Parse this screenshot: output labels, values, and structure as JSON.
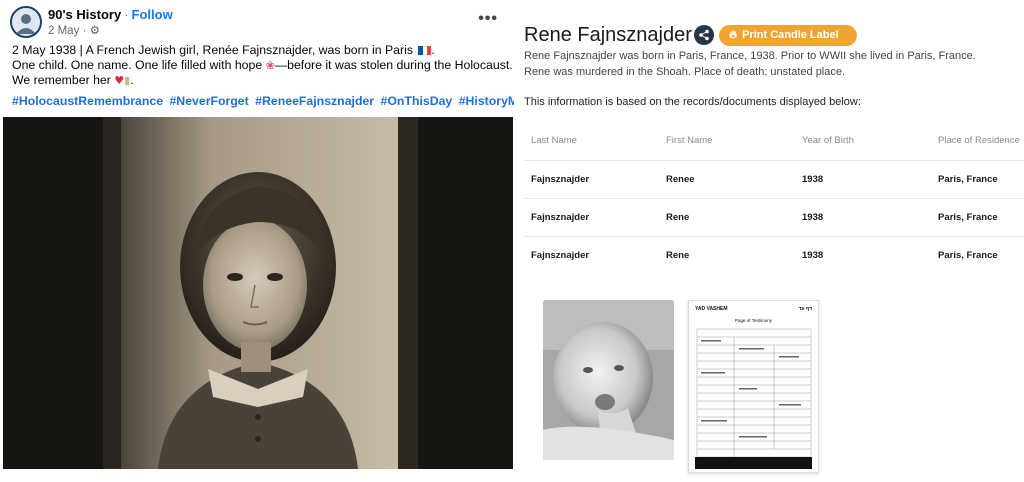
{
  "post": {
    "author": "90's History",
    "separator": "·",
    "follow_label": "Follow",
    "date": "2 May",
    "date_separator": "·",
    "more_label": "•••",
    "lines": [
      "2 May 1938 | A French Jewish girl, Renée Fajnsznajder, was born in Paris",
      "One child. One name. One life filled with hope",
      "—before it was stolen during the Holocaust.",
      "We remember her"
    ],
    "period": ".",
    "hashtags": [
      "#HolocaustRemembrance",
      "#NeverForget",
      "#ReneeFajnsznajder",
      "#OnThisDay",
      "#HistoryMatters"
    ],
    "emoji_flower": "❀",
    "emoji_heart": "♥",
    "icons": {
      "avatar": "avatar-icon",
      "globe": "gear-icon",
      "flag": "france-flag-icon",
      "more": "more-icon"
    },
    "flag_colors": [
      "#0055a4",
      "#ffffff",
      "#ef4135"
    ]
  },
  "record": {
    "title": "Rene Fajnsznajder",
    "share_icon": "share-icon",
    "candle_icon": "flame-icon",
    "candle_label": "Print Candle Label",
    "description": [
      "Rene Fajnsznajder was born in Paris, France, 1938. Prior to WWII she lived in Paris, France.",
      "Rene was murdered in the Shoah. Place of death: unstated place."
    ],
    "info": "This information is based on the records/documents displayed below:",
    "table": {
      "headers": [
        "Last Name",
        "First Name",
        "Year of Birth",
        "Place of Residence"
      ],
      "rows": [
        [
          "Fajnsznajder",
          "Renee",
          "1938",
          "Paris, France"
        ],
        [
          "Fajnsznajder",
          "Rene",
          "1938",
          "Paris, France"
        ],
        [
          "Fajnsznajder",
          "Rene",
          "1938",
          "Paris, France"
        ]
      ]
    },
    "document": {
      "header_left": "YAD VASHEM",
      "header_right": "דף עד",
      "subtitle": "Page of Testimony"
    },
    "colors": {
      "accent": "#f0a531",
      "share_bg": "#263648"
    }
  }
}
